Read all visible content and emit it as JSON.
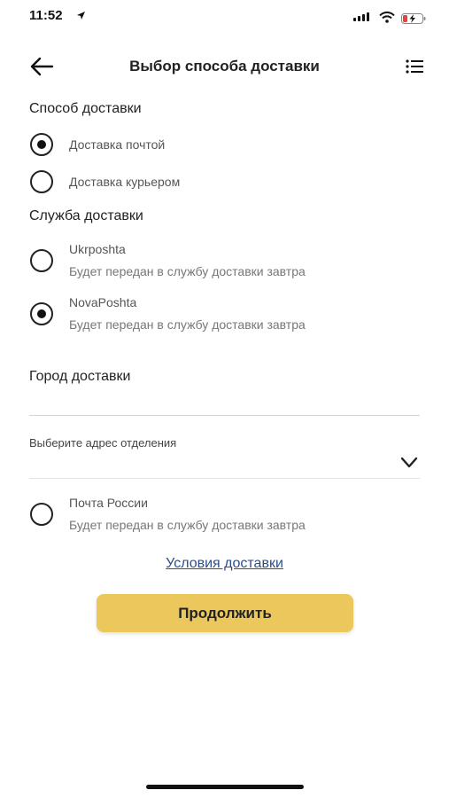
{
  "status_bar": {
    "time": "11:52"
  },
  "header": {
    "title": "Выбор способа доставки"
  },
  "delivery_method": {
    "title": "Способ доставки",
    "options": [
      {
        "label": "Доставка почтой",
        "selected": true
      },
      {
        "label": "Доставка курьером",
        "selected": false
      }
    ]
  },
  "delivery_service": {
    "title": "Служба доставки",
    "options": [
      {
        "name": "Ukrposhta",
        "note": "Будет передан в службу доставки завтра",
        "selected": false
      },
      {
        "name": "NovaPoshta",
        "note": "Будет передан в службу доставки завтра",
        "selected": true
      },
      {
        "name": "Почта России",
        "note": "Будет передан в службу доставки завтра",
        "selected": false
      }
    ]
  },
  "city": {
    "title": "Город доставки"
  },
  "branch": {
    "label": "Выберите адрес отделения"
  },
  "links": {
    "terms": "Условия доставки"
  },
  "buttons": {
    "continue": "Продолжить"
  },
  "colors": {
    "accent": "#ecc85c",
    "link": "#2d4e8a",
    "battery_low": "#e0463d"
  }
}
